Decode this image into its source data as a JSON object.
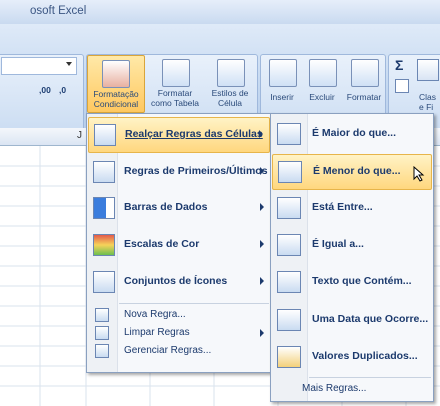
{
  "window": {
    "title": "osoft Excel"
  },
  "ribbon": {
    "conditional_formatting": {
      "line1": "Formatação",
      "line2": "Condicional"
    },
    "format_as_table": {
      "line1": "Formatar",
      "line2": "como Tabela"
    },
    "cell_styles": {
      "line1": "Estilos de",
      "line2": "Célula"
    },
    "insert": "Inserir",
    "delete": "Excluir",
    "format": "Formatar",
    "sigma": "Σ",
    "sort_filter": {
      "line1": "Clas",
      "line2": "e Fi"
    },
    "decimal_increase": ",00",
    "decimal_decrease": ",0"
  },
  "sheet": {
    "column_label": "J"
  },
  "main_menu": {
    "items": [
      {
        "label": "Realçar Regras das Células",
        "highlighted": true,
        "submenu": true
      },
      {
        "label": "Regras de Primeiros/Últimos",
        "submenu": true
      },
      {
        "label": "Barras de Dados",
        "submenu": true
      },
      {
        "label": "Escalas de Cor",
        "submenu": true
      },
      {
        "label": "Conjuntos de Ícones",
        "submenu": true
      }
    ],
    "small_items": [
      {
        "label": "Nova Regra..."
      },
      {
        "label": "Limpar Regras",
        "submenu": true
      },
      {
        "label": "Gerenciar Regras..."
      }
    ]
  },
  "sub_menu": {
    "items": [
      {
        "label": "É Maior do que..."
      },
      {
        "label": "É Menor do que...",
        "highlighted": true
      },
      {
        "label": "Está Entre..."
      },
      {
        "label": "É Igual a..."
      },
      {
        "label": "Texto que Contém..."
      },
      {
        "label": "Uma Data que Ocorre..."
      },
      {
        "label": "Valores Duplicados..."
      }
    ],
    "more": "Mais Regras..."
  }
}
